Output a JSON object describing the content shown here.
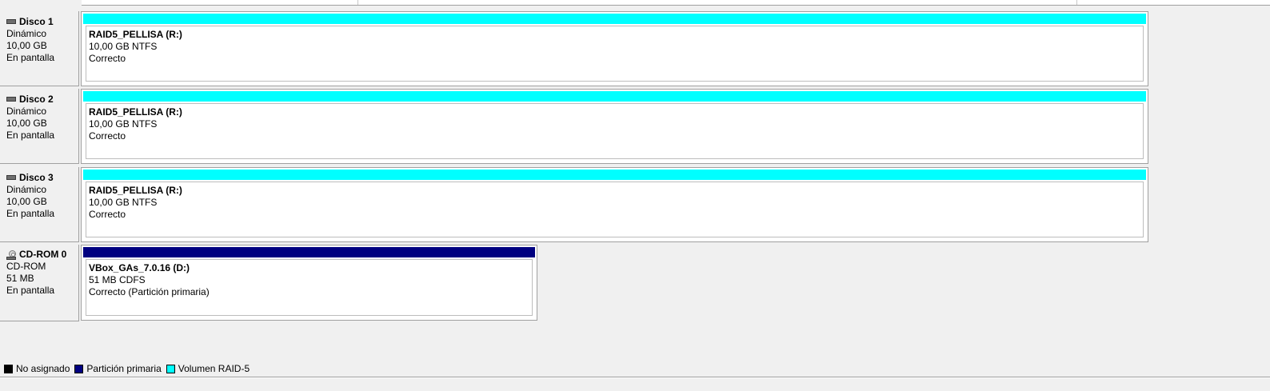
{
  "colors": {
    "raid5": "#00ffff",
    "primary": "#000080",
    "unallocated": "#000000"
  },
  "disks": [
    {
      "name": "Disco 1",
      "type": "Dinámico",
      "size": "10,00 GB",
      "status": "En pantalla",
      "icon": "hard-disk-icon",
      "volume": {
        "label": "RAID5_PELLISA  (R:)",
        "details": "10,00 GB NTFS",
        "status": "Correcto",
        "kind": "raid5"
      }
    },
    {
      "name": "Disco 2",
      "type": "Dinámico",
      "size": "10,00 GB",
      "status": "En pantalla",
      "icon": "hard-disk-icon",
      "volume": {
        "label": "RAID5_PELLISA  (R:)",
        "details": "10,00 GB NTFS",
        "status": "Correcto",
        "kind": "raid5"
      }
    },
    {
      "name": "Disco 3",
      "type": "Dinámico",
      "size": "10,00 GB",
      "status": "En pantalla",
      "icon": "hard-disk-icon",
      "volume": {
        "label": "RAID5_PELLISA  (R:)",
        "details": "10,00 GB NTFS",
        "status": "Correcto",
        "kind": "raid5"
      }
    },
    {
      "name": "CD-ROM 0",
      "type": "CD-ROM",
      "size": "51 MB",
      "status": "En pantalla",
      "icon": "cd-rom-icon",
      "volume": {
        "label": "VBox_GAs_7.0.16  (D:)",
        "details": "51 MB CDFS",
        "status": "Correcto (Partición primaria)",
        "kind": "primary"
      }
    }
  ],
  "legend": [
    {
      "label": "No asignado",
      "color": "#000000"
    },
    {
      "label": "Partición primaria",
      "color": "#000080"
    },
    {
      "label": "Volumen RAID-5",
      "color": "#00ffff"
    }
  ]
}
